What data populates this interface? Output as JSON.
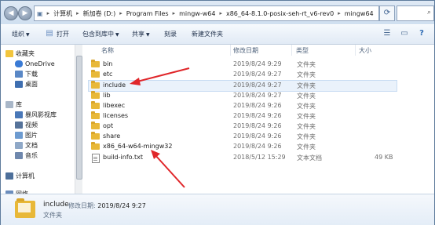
{
  "address": {
    "crumbs": [
      "计算机",
      "新加卷 (D:)",
      "Program Files",
      "mingw-w64",
      "x86_64-8.1.0-posix-seh-rt_v6-rev0",
      "mingw64"
    ]
  },
  "toolbar": {
    "organize": "组织",
    "open": "打开",
    "include_in_library": "包含到库中",
    "share": "共享",
    "burn": "刻录",
    "new_folder": "新建文件夹"
  },
  "nav": {
    "favorites": "收藏夹",
    "onedrive": "OneDrive",
    "downloads": "下载",
    "desktop": "桌面",
    "library": "库",
    "storm_video": "暴风影视库",
    "videos": "视频",
    "pictures": "图片",
    "documents": "文档",
    "music": "音乐",
    "computer": "计算机",
    "network": "网络"
  },
  "columns": {
    "name": "名称",
    "date": "修改日期",
    "type": "类型",
    "size": "大小"
  },
  "files": [
    {
      "name": "bin",
      "date": "2019/8/24 9:29",
      "type": "文件夹",
      "size": "",
      "kind": "folder"
    },
    {
      "name": "etc",
      "date": "2019/8/24 9:27",
      "type": "文件夹",
      "size": "",
      "kind": "folder"
    },
    {
      "name": "include",
      "date": "2019/8/24 9:27",
      "type": "文件夹",
      "size": "",
      "kind": "folder"
    },
    {
      "name": "lib",
      "date": "2019/8/24 9:27",
      "type": "文件夹",
      "size": "",
      "kind": "folder"
    },
    {
      "name": "libexec",
      "date": "2019/8/24 9:26",
      "type": "文件夹",
      "size": "",
      "kind": "folder"
    },
    {
      "name": "licenses",
      "date": "2019/8/24 9:26",
      "type": "文件夹",
      "size": "",
      "kind": "folder"
    },
    {
      "name": "opt",
      "date": "2019/8/24 9:26",
      "type": "文件夹",
      "size": "",
      "kind": "folder"
    },
    {
      "name": "share",
      "date": "2019/8/24 9:26",
      "type": "文件夹",
      "size": "",
      "kind": "folder"
    },
    {
      "name": "x86_64-w64-mingw32",
      "date": "2019/8/24 9:26",
      "type": "文件夹",
      "size": "",
      "kind": "folder"
    },
    {
      "name": "build-info.txt",
      "date": "2018/5/12 15:29",
      "type": "文本文档",
      "size": "49 KB",
      "kind": "text"
    }
  ],
  "details": {
    "name": "include",
    "modified_label": "修改日期:",
    "modified_value": "2019/8/24 9:27",
    "type": "文件夹"
  },
  "colors": {
    "annotation_arrow": "#e0262a",
    "folder": "#e8b838",
    "selection": "#eaf2fb"
  }
}
